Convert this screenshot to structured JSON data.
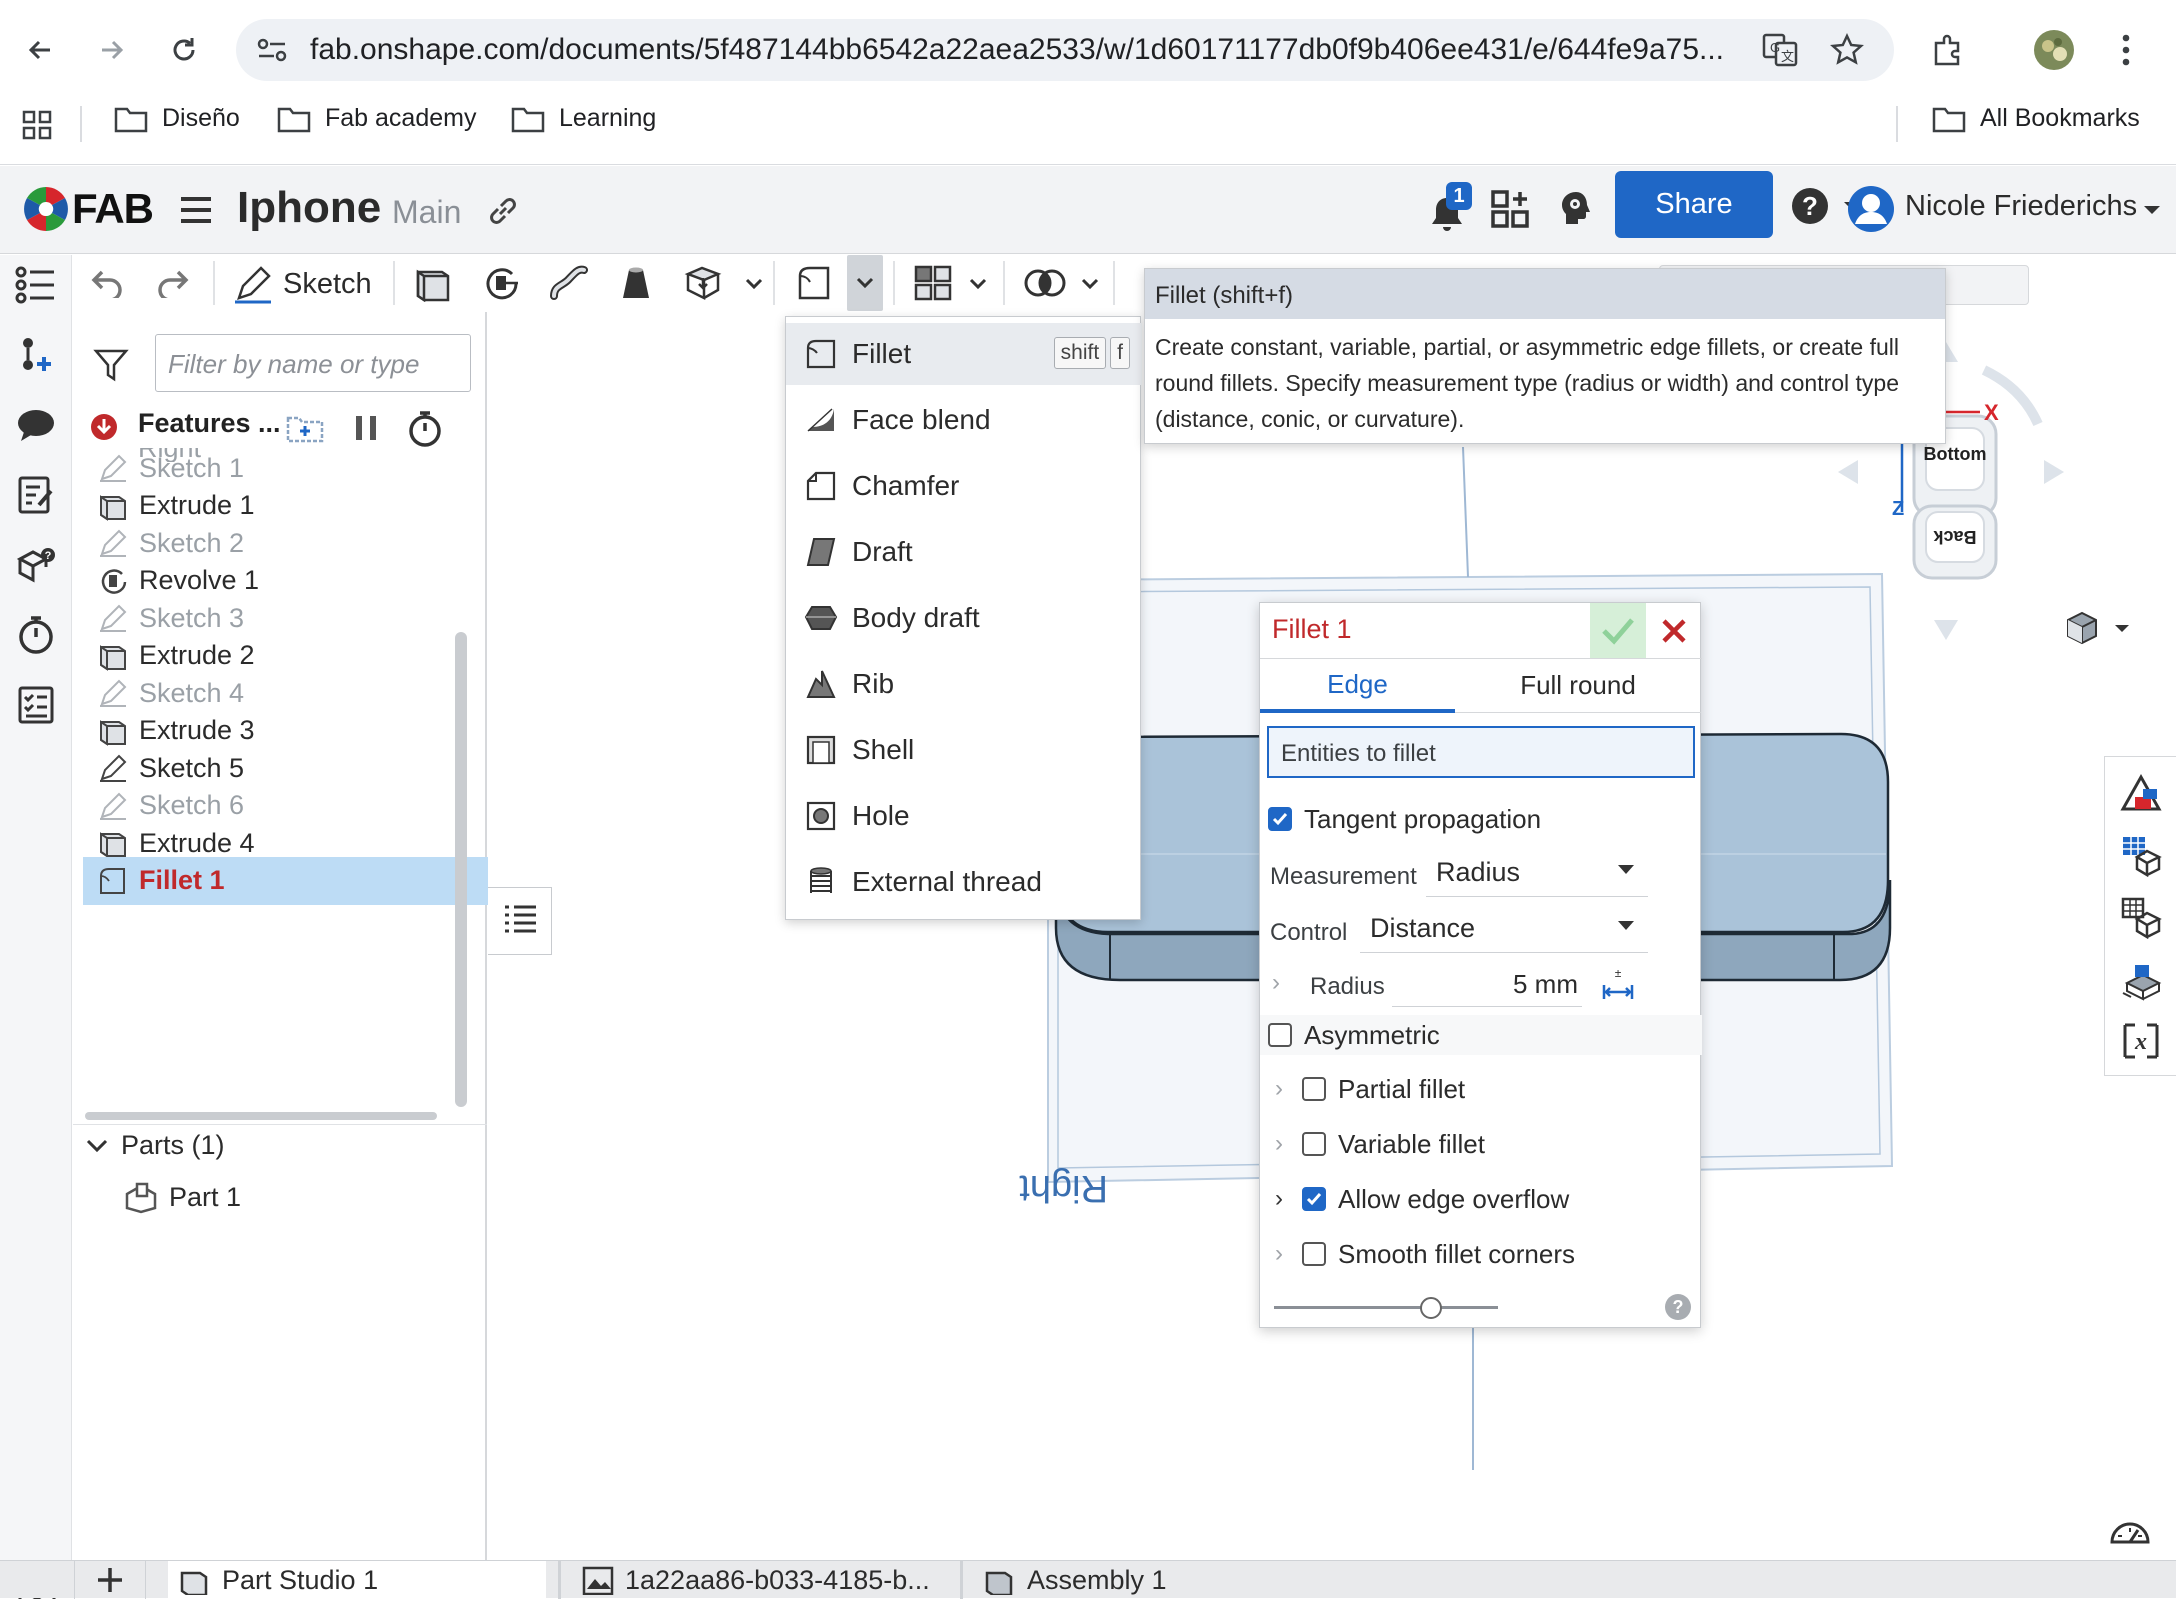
{
  "browser": {
    "url": "fab.onshape.com/documents/5f487144bb6542a22aea2533/w/1d60171177db0f9b406ee431/e/644fe9a75...",
    "bookmarks": [
      "Diseño",
      "Fab academy",
      "Learning"
    ],
    "all_bookmarks": "All Bookmarks"
  },
  "header": {
    "logo": "FAB",
    "document_name": "Iphone",
    "branch": "Main",
    "notification_count": "1",
    "share_label": "Share",
    "user_name": "Nicole Friederichs"
  },
  "toolbar": {
    "sketch_label": "Sketch"
  },
  "feature_panel": {
    "filter_placeholder": "Filter by name or type",
    "features_title": "Features ...",
    "partial_top_item": "Right",
    "features": [
      {
        "label": "Sketch 1",
        "type": "sketch"
      },
      {
        "label": "Extrude 1",
        "type": "extrude"
      },
      {
        "label": "Sketch 2",
        "type": "sketch"
      },
      {
        "label": "Revolve 1",
        "type": "revolve"
      },
      {
        "label": "Sketch 3",
        "type": "sketch"
      },
      {
        "label": "Extrude 2",
        "type": "extrude"
      },
      {
        "label": "Sketch 4",
        "type": "sketch"
      },
      {
        "label": "Extrude 3",
        "type": "extrude"
      },
      {
        "label": "Sketch 5",
        "type": "sketch-active"
      },
      {
        "label": "Sketch 6",
        "type": "sketch"
      },
      {
        "label": "Extrude 4",
        "type": "extrude"
      },
      {
        "label": "Fillet 1",
        "type": "fillet-selected"
      }
    ],
    "parts_header": "Parts (1)",
    "parts": [
      "Part 1"
    ]
  },
  "fillet_menu": {
    "items": [
      "Fillet",
      "Face blend",
      "Chamfer",
      "Draft",
      "Body draft",
      "Rib",
      "Shell",
      "Hole",
      "External thread"
    ],
    "shortcut_keys": [
      "shift",
      "f"
    ]
  },
  "tooltip": {
    "title": "Fillet (shift+f)",
    "body": "Create constant, variable, partial, or asymmetric edge fillets, or create full round fillets. Specify measurement type (radius or width) and control type (distance, conic, or curvature)."
  },
  "view_cube": {
    "faces": [
      "Bottom",
      "Back"
    ],
    "axes": [
      "X",
      "Z"
    ]
  },
  "viewport": {
    "plane_label": "Right"
  },
  "fillet_dialog": {
    "title": "Fillet 1",
    "tabs": [
      "Edge",
      "Full round"
    ],
    "entities_placeholder": "Entities to fillet",
    "tangent_propagation": {
      "label": "Tangent propagation",
      "checked": true
    },
    "measurement": {
      "label": "Measurement",
      "value": "Radius"
    },
    "control": {
      "label": "Control",
      "value": "Distance"
    },
    "radius": {
      "label": "Radius",
      "value": "5 mm"
    },
    "asymmetric": {
      "label": "Asymmetric",
      "checked": false
    },
    "partial_fillet": {
      "label": "Partial fillet",
      "checked": false
    },
    "variable_fillet": {
      "label": "Variable fillet",
      "checked": false
    },
    "allow_edge_overflow": {
      "label": "Allow edge overflow",
      "checked": true
    },
    "smooth_fillet_corners": {
      "label": "Smooth fillet corners",
      "checked": false
    }
  },
  "bottom_tabs": [
    "Part Studio 1",
    "1a22aa86-b033-4185-b...",
    "Assembly 1"
  ],
  "colors": {
    "accent": "#1f67c6",
    "selected_red": "#c0292b",
    "part_blue": "#a9c2d8"
  }
}
